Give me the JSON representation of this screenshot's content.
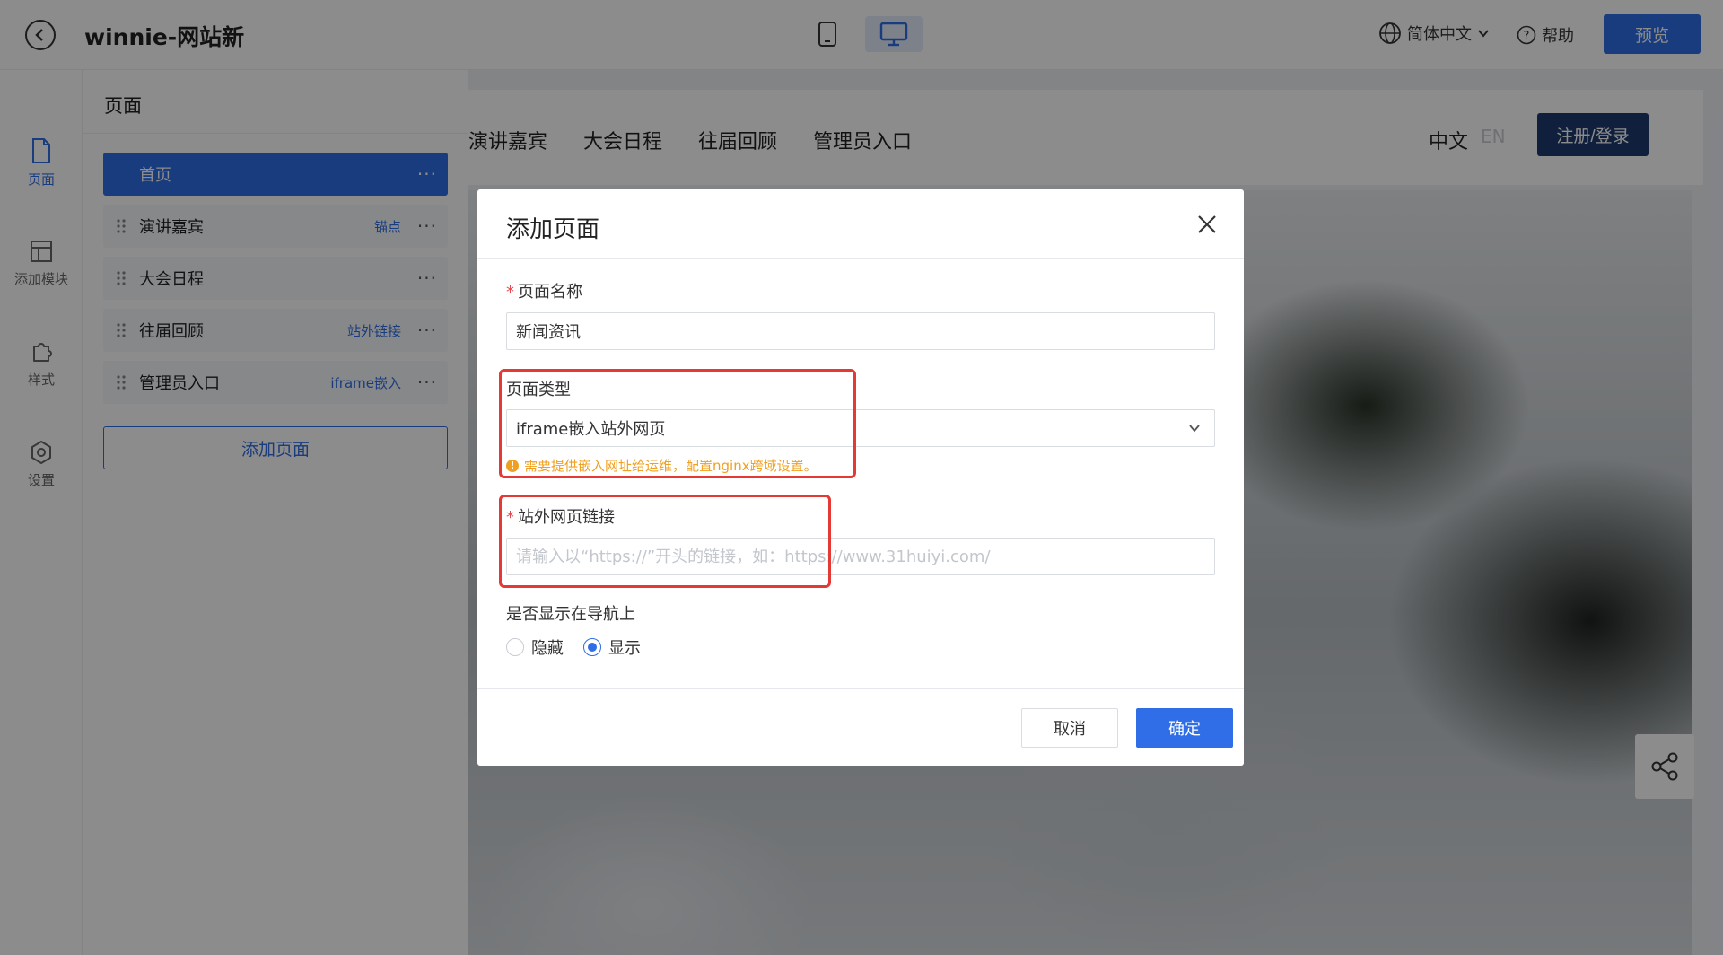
{
  "header": {
    "site_title": "winnie-网站新",
    "language": "简体中文",
    "help": "帮助",
    "preview": "预览"
  },
  "rail": {
    "items": [
      {
        "label": "页面",
        "icon": "file-icon",
        "active": true
      },
      {
        "label": "添加模块",
        "icon": "layout-icon",
        "active": false
      },
      {
        "label": "样式",
        "icon": "puzzle-icon",
        "active": false
      },
      {
        "label": "设置",
        "icon": "gear-icon",
        "active": false
      }
    ]
  },
  "panel": {
    "title": "页面",
    "pages": [
      {
        "name": "首页",
        "tag": "",
        "active": true
      },
      {
        "name": "演讲嘉宾",
        "tag": "锚点",
        "active": false
      },
      {
        "name": "大会日程",
        "tag": "",
        "active": false
      },
      {
        "name": "往届回顾",
        "tag": "站外链接",
        "active": false
      },
      {
        "name": "管理员入口",
        "tag": "iframe嵌入",
        "active": false
      }
    ],
    "add_page": "添加页面"
  },
  "site": {
    "nav": [
      "演讲嘉宾",
      "大会日程",
      "往届回顾",
      "管理员入口"
    ],
    "lang_zh": "中文",
    "lang_en": "EN",
    "register": "注册/登录"
  },
  "modal": {
    "title": "添加页面",
    "page_name_label": "页面名称",
    "page_name_value": "新闻资讯",
    "page_type_label": "页面类型",
    "page_type_value": "iframe嵌入站外网页",
    "page_type_hint": "需要提供嵌入网址给运维，配置nginx跨域设置。",
    "link_label": "站外网页链接",
    "link_placeholder": "请输入以“https://”开头的链接，如：https://www.31huiyi.com/",
    "nav_display_label": "是否显示在导航上",
    "option_hide": "隐藏",
    "option_show": "显示",
    "selected": "显示",
    "cancel": "取消",
    "confirm": "确定"
  },
  "colors": {
    "accent": "#2f6ee6",
    "highlight": "#e53935",
    "warning": "#f0a020"
  }
}
